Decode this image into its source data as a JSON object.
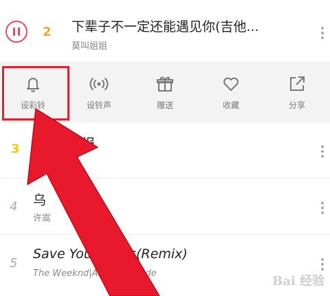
{
  "now_playing": {
    "rank": "2",
    "title": "下辈子不一定还能遇见你(吉他...",
    "artist": "莫叫姐姐"
  },
  "actions": [
    {
      "label": "设彩铃",
      "icon": "bell-icon"
    },
    {
      "label": "设铃声",
      "icon": "ringtone-icon"
    },
    {
      "label": "赠送",
      "icon": "gift-icon"
    },
    {
      "label": "收藏",
      "icon": "heart-icon"
    },
    {
      "label": "分享",
      "icon": "share-icon"
    }
  ],
  "songs": [
    {
      "rank": "3",
      "title": "画报",
      "artist": ""
    },
    {
      "rank": "4",
      "title": "乌",
      "artist": "许嵩"
    },
    {
      "rank": "5",
      "title": "Save Your Tears(Remix)",
      "artist": "The Weeknd|Ariana Grande"
    }
  ],
  "watermark": "Bai 经验",
  "colors": {
    "accent": "#e34b5a",
    "rank_orange": "#f5a623",
    "rank_yellow": "#f6c90e",
    "highlight": "#d9232f"
  }
}
